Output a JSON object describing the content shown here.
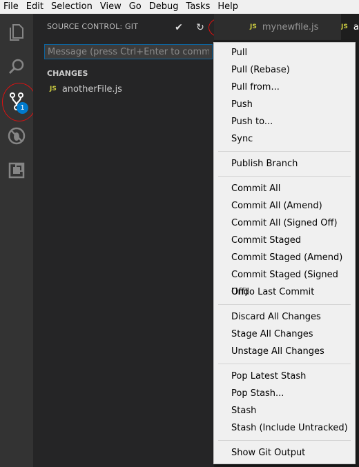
{
  "menubar": [
    "File",
    "Edit",
    "Selection",
    "View",
    "Go",
    "Debug",
    "Tasks",
    "Help"
  ],
  "activity": {
    "icons": [
      "explorer-icon",
      "search-icon",
      "source-control-icon",
      "debug-icon",
      "extensions-icon"
    ],
    "scm_badge": "1"
  },
  "scm": {
    "title": "SOURCE CONTROL: GIT",
    "commit_glyph": "✔",
    "refresh_glyph": "↻",
    "more_glyph": "···",
    "message_placeholder": "Message (press Ctrl+Enter to commit)",
    "changes_label": "CHANGES",
    "files": [
      {
        "name": "anotherFile.js",
        "type": "JS"
      }
    ]
  },
  "tabs": [
    {
      "label": "mynewfile.js",
      "type": "JS"
    },
    {
      "label": "a",
      "type": "JS"
    }
  ],
  "menu": {
    "groups": [
      [
        "Pull",
        "Pull (Rebase)",
        "Pull from...",
        "Push",
        "Push to...",
        "Sync"
      ],
      [
        "Publish Branch"
      ],
      [
        "Commit All",
        "Commit All (Amend)",
        "Commit All (Signed Off)",
        "Commit Staged",
        "Commit Staged (Amend)",
        "Commit Staged (Signed Off)",
        "Undo Last Commit"
      ],
      [
        "Discard All Changes",
        "Stage All Changes",
        "Unstage All Changes"
      ],
      [
        "Pop Latest Stash",
        "Pop Stash...",
        "Stash",
        "Stash (Include Untracked)"
      ],
      [
        "Show Git Output"
      ]
    ]
  },
  "colors": {
    "accent": "#007acc",
    "annotation": "#e01010",
    "js": "#cbcb41"
  }
}
